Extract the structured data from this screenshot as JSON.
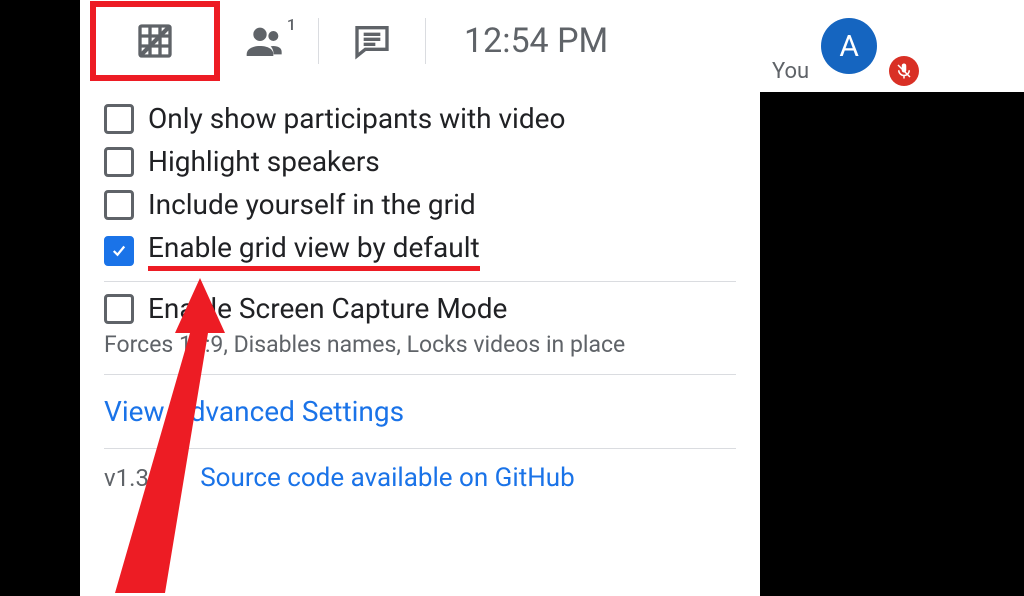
{
  "toolbar": {
    "clock": "12:54 PM",
    "participants_count": "1"
  },
  "options": {
    "only_video": "Only show participants with video",
    "highlight_speakers": "Highlight speakers",
    "include_self": "Include yourself in the grid",
    "enable_grid_default": "Enable grid view by default",
    "screen_capture": "Enable Screen Capture Mode",
    "screen_capture_sub": "Forces 16:9, Disables names, Locks videos in place"
  },
  "links": {
    "advanced": "View Advanced Settings",
    "source": "Source code available on GitHub"
  },
  "footer": {
    "version": "v1.39.0"
  },
  "user": {
    "you_label": "You",
    "avatar_initial": "A"
  }
}
